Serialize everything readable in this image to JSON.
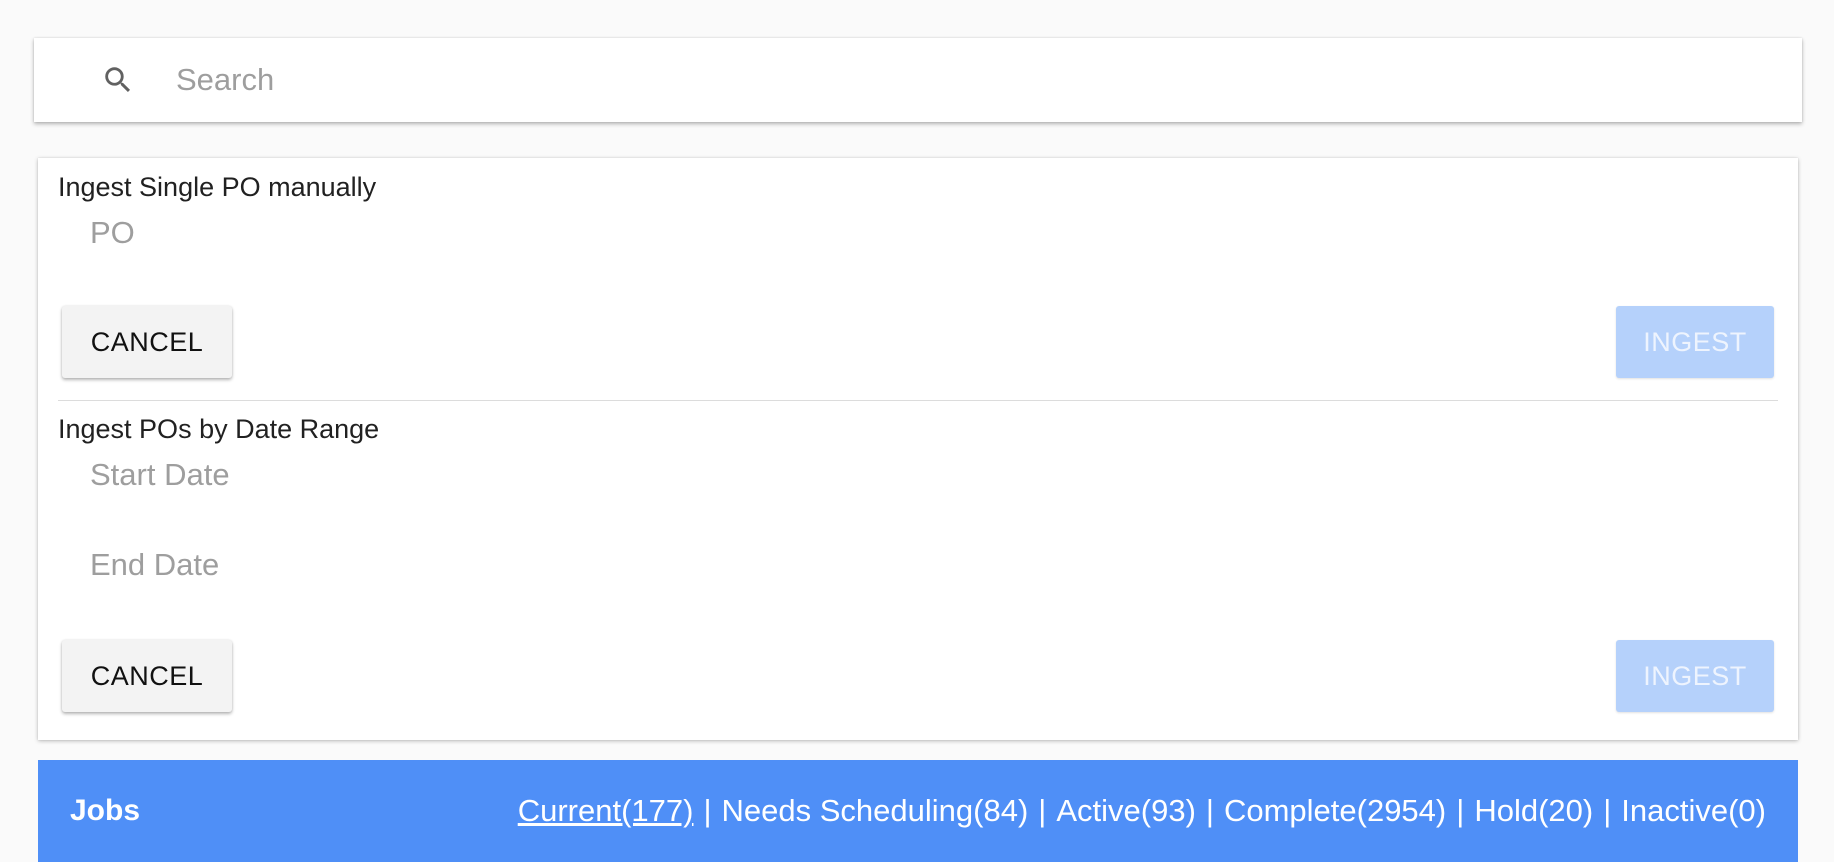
{
  "search": {
    "placeholder": "Search",
    "icon": "search-icon"
  },
  "single_po": {
    "title": "Ingest Single PO manually",
    "po_placeholder": "PO",
    "cancel_label": "CANCEL",
    "ingest_label": "INGEST"
  },
  "date_range": {
    "title": "Ingest POs by Date Range",
    "start_placeholder": "Start Date",
    "end_placeholder": "End Date",
    "cancel_label": "CANCEL",
    "ingest_label": "INGEST"
  },
  "jobs": {
    "title": "Jobs",
    "filters": [
      {
        "label": "Current(177)",
        "active": true
      },
      {
        "label": "Needs Scheduling(84)",
        "active": false
      },
      {
        "label": "Active(93)",
        "active": false
      },
      {
        "label": "Complete(2954)",
        "active": false
      },
      {
        "label": "Hold(20)",
        "active": false
      },
      {
        "label": "Inactive(0)",
        "active": false
      }
    ],
    "separator": "|"
  },
  "colors": {
    "jobs_bar": "#4f8ff7",
    "ingest_disabled": "#b5d1fb",
    "cancel_bg": "#f3f3f3"
  }
}
